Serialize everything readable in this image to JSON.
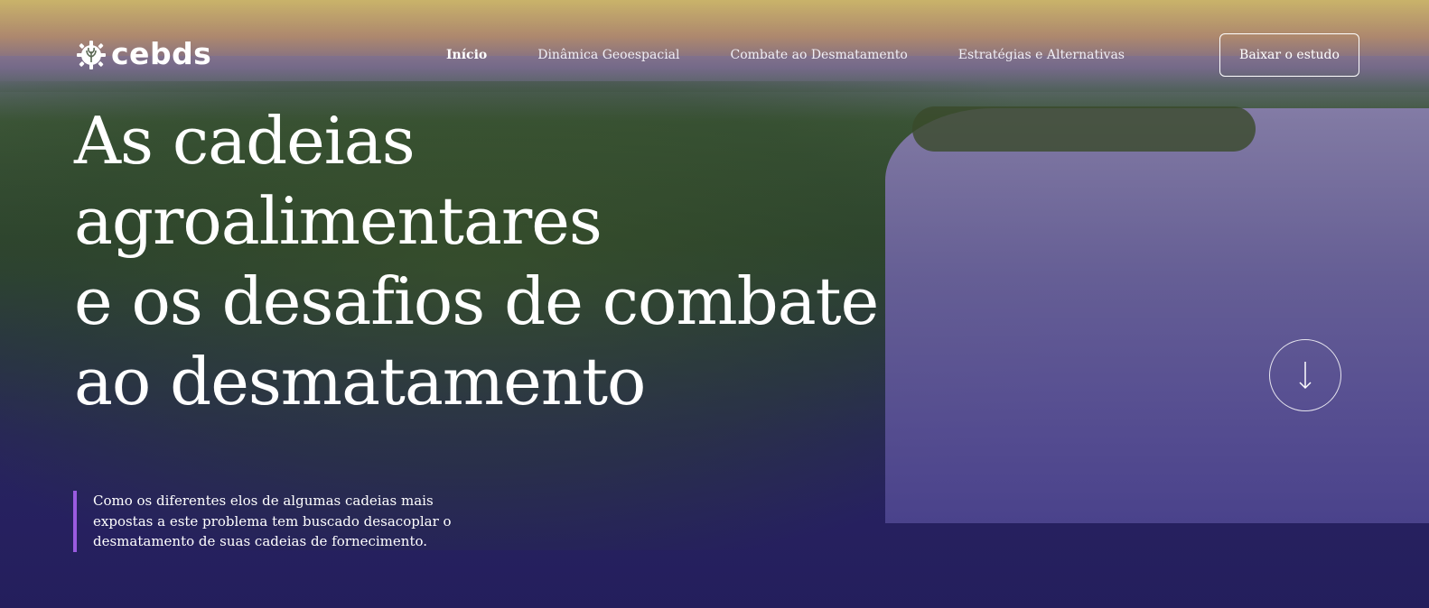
{
  "brand": {
    "name": "cebds",
    "icon": "gear-leaf-icon"
  },
  "nav": {
    "items": [
      {
        "label": "Início",
        "active": true
      },
      {
        "label": "Dinâmica Geoespacial",
        "active": false
      },
      {
        "label": "Combate ao Desmatamento",
        "active": false
      },
      {
        "label": "Estratégias e Alternativas",
        "active": false
      }
    ],
    "cta_label": "Baixar o estudo"
  },
  "hero": {
    "headline_lines": [
      "As cadeias",
      "agroalimentares",
      "e os desafios de combate",
      "ao desmatamento"
    ],
    "description": "Como os diferentes elos de algumas cadeias mais expostas a este problema tem buscado desacoplar o desmatamento de suas cadeias de fornecimento.",
    "scroll_icon": "arrow-down-icon"
  },
  "colors": {
    "accent_bar": "#9a5be0",
    "overlay": "#2a2a66"
  }
}
